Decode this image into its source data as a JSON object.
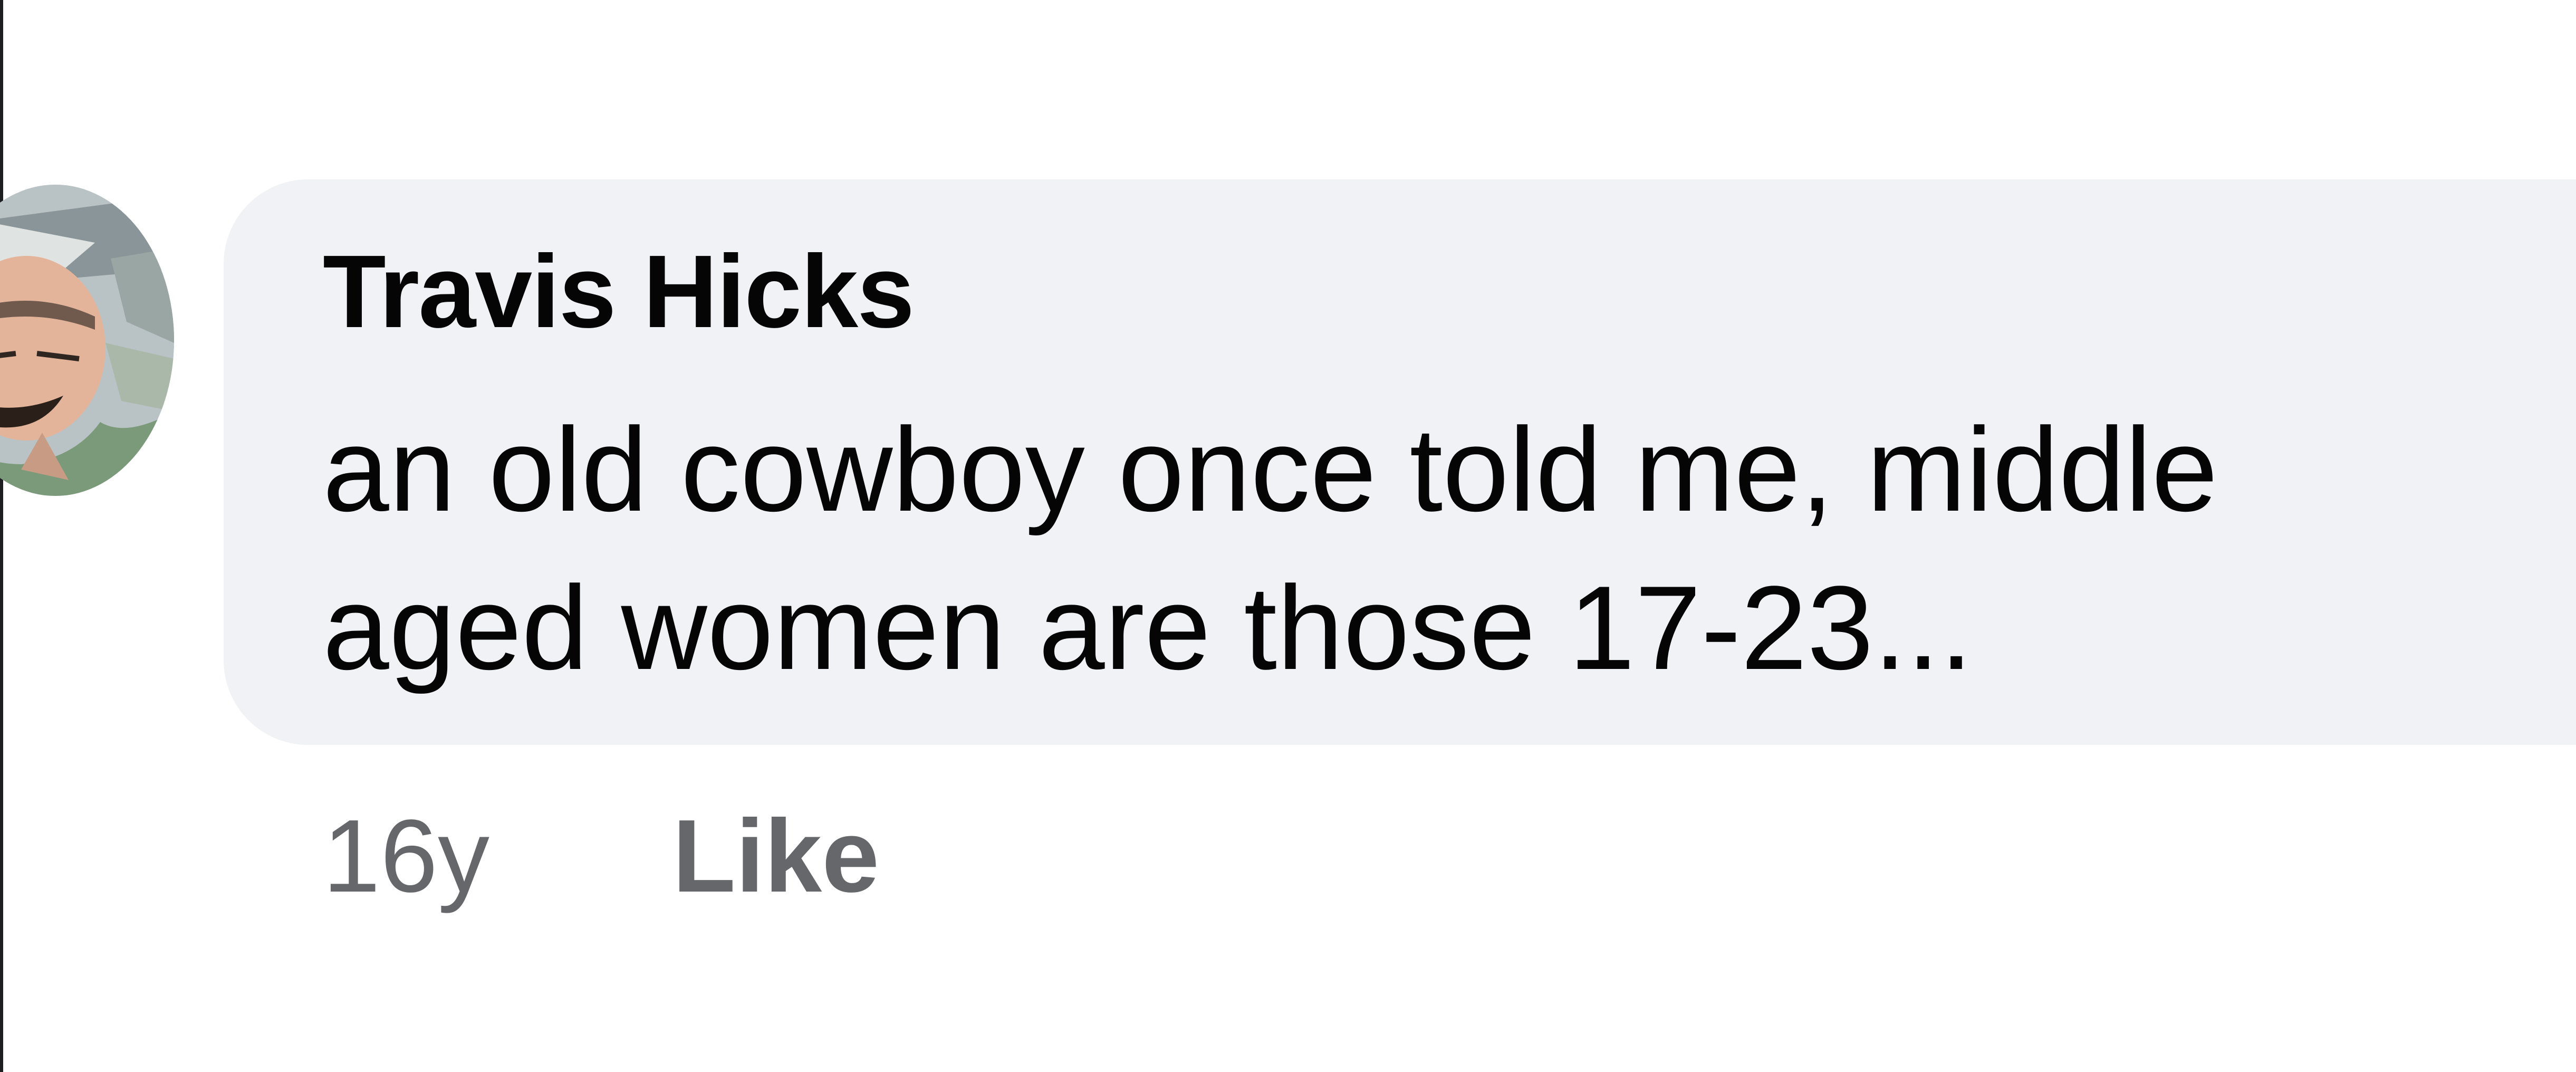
{
  "comment": {
    "author": "Travis Hicks",
    "lines": [
      "an old cowboy once told me, middle",
      "aged women are those 17-23..."
    ],
    "timestamp": "16y",
    "like_label": "Like",
    "avatar_icon": "cowboy-portrait-avatar",
    "colors": {
      "bubble": "#f0f2f5",
      "text": "#050505",
      "meta": "#65676b"
    }
  }
}
